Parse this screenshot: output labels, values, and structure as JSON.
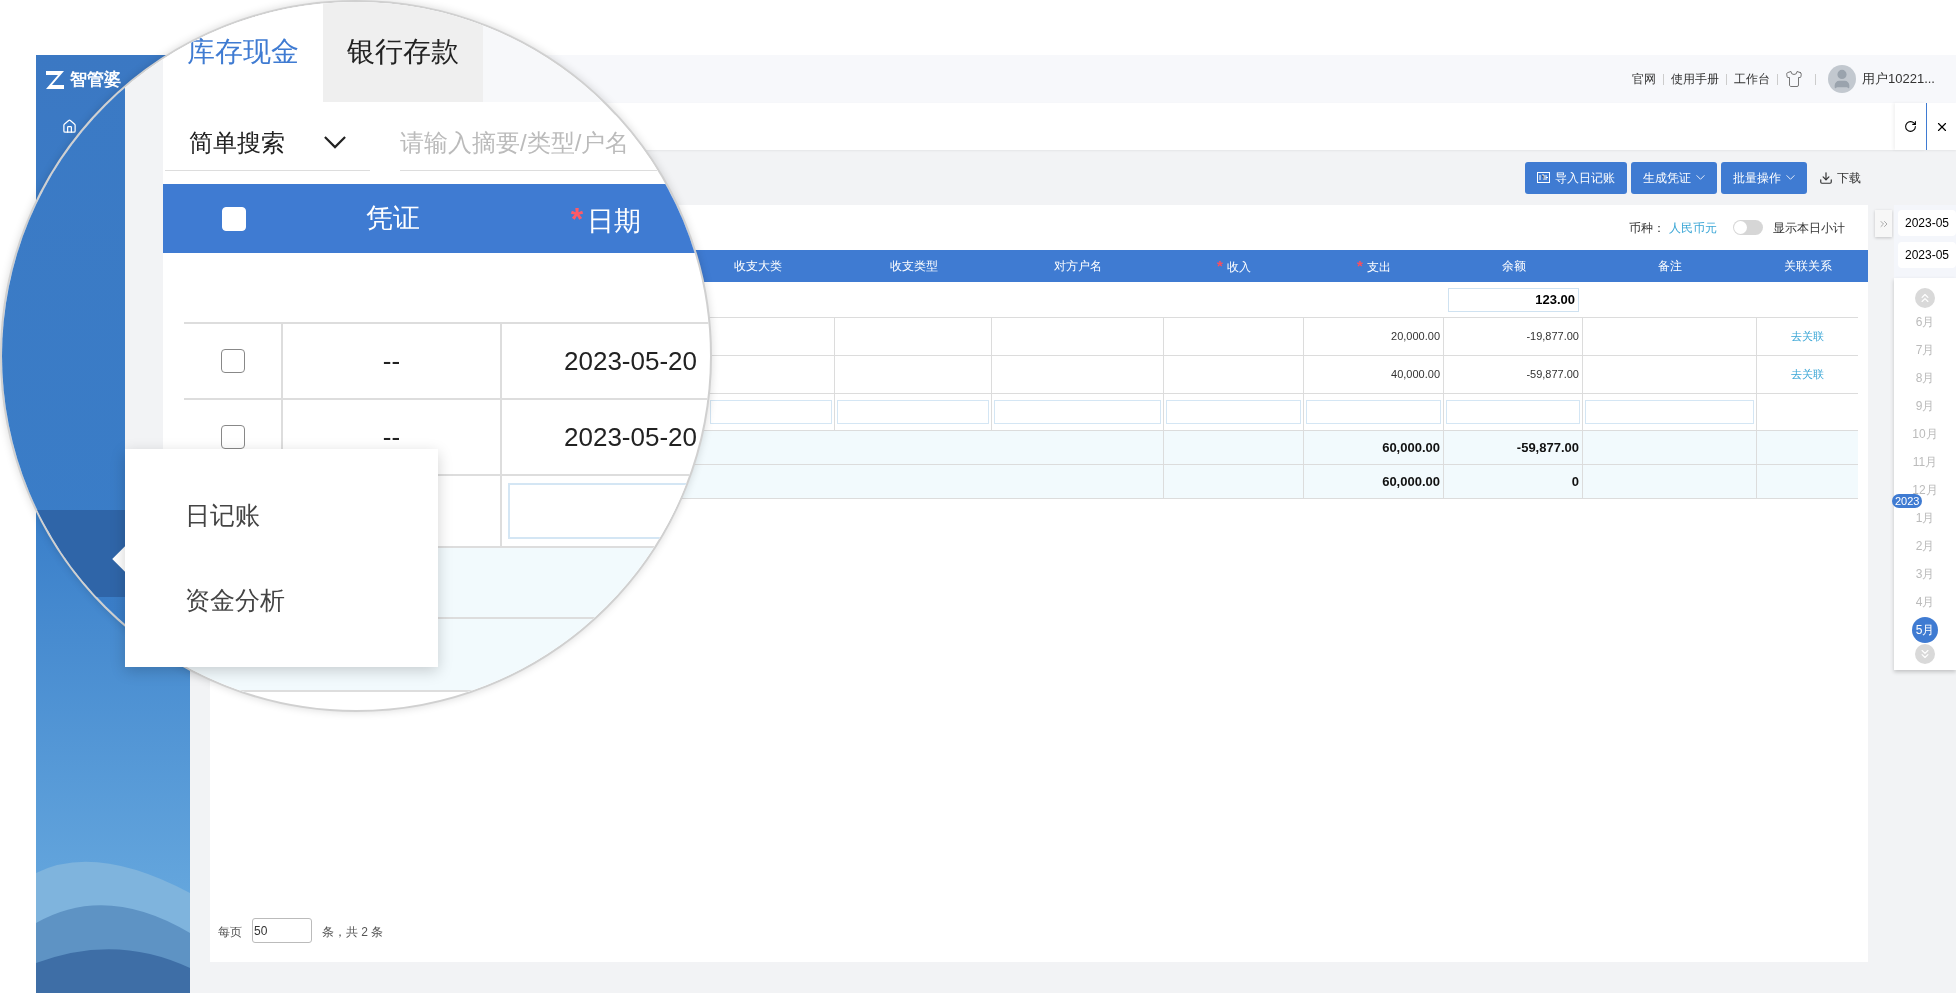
{
  "app": {
    "logo": "智管婆"
  },
  "header": {
    "links": [
      "官网",
      "使用手册",
      "工作台"
    ],
    "user": "用户10221..."
  },
  "toolbar": {
    "buttons": [
      {
        "label": "导入日记账",
        "kind": "import"
      },
      {
        "label": "生成凭证",
        "kind": "dropdown"
      },
      {
        "label": "批量操作",
        "kind": "dropdown"
      }
    ],
    "download": "下载"
  },
  "filters": {
    "currency_label": "币种：",
    "currency": "人民币元",
    "toggle": {
      "label": "显示本日小计",
      "on": false
    }
  },
  "table": {
    "columns": [
      {
        "label": "收支大类"
      },
      {
        "label": "收支类型"
      },
      {
        "label": "对方户名"
      },
      {
        "label": "收入",
        "mark": "*"
      },
      {
        "label": "支出",
        "mark": "*"
      },
      {
        "label": "余额"
      },
      {
        "label": "备注"
      },
      {
        "label": "关联关系"
      }
    ],
    "opening_balance": "123.00",
    "rows": [
      {
        "expense": "20,000.00",
        "balance": "-19,877.00",
        "action": "去关联"
      },
      {
        "expense": "40,000.00",
        "balance": "-59,877.00",
        "action": "去关联"
      }
    ],
    "totals": [
      {
        "expense": "60,000.00",
        "balance": "-59,877.00"
      },
      {
        "expense": "60,000.00",
        "balance": "0"
      }
    ]
  },
  "pagination": {
    "label": "每页",
    "page_size": "50",
    "summary": "条，共 2 条"
  },
  "date_panel": {
    "from": "2023-05",
    "to": "2023-05",
    "months": [
      {
        "label": "6月",
        "selected": false
      },
      {
        "label": "7月",
        "selected": false
      },
      {
        "label": "8月",
        "selected": false
      },
      {
        "label": "9月",
        "selected": false
      },
      {
        "label": "10月",
        "selected": false
      },
      {
        "label": "11月",
        "selected": false
      },
      {
        "label": "12月",
        "selected": false
      },
      {
        "label": "1月",
        "selected": false,
        "year": "2023"
      },
      {
        "label": "2月",
        "selected": false
      },
      {
        "label": "3月",
        "selected": false
      },
      {
        "label": "4月",
        "selected": false
      },
      {
        "label": "5月",
        "selected": true
      }
    ]
  },
  "magnifier": {
    "tabs": [
      {
        "label": "库存现金",
        "selected": true
      },
      {
        "label": "银行存款",
        "selected": false
      }
    ],
    "search_mode": "简单搜索",
    "search_placeholder": "请输入摘要/类型/户名",
    "header_checked": false,
    "columns": [
      {
        "label": "凭证"
      },
      {
        "label": "日期",
        "mark": "*"
      }
    ],
    "rows": [
      {
        "voucher": "--",
        "date": "2023-05-20",
        "checked": false
      },
      {
        "voucher": "--",
        "date": "2023-05-20",
        "checked": false
      }
    ]
  },
  "flyout_menu": {
    "items": [
      "日记账",
      "资金分析"
    ]
  }
}
